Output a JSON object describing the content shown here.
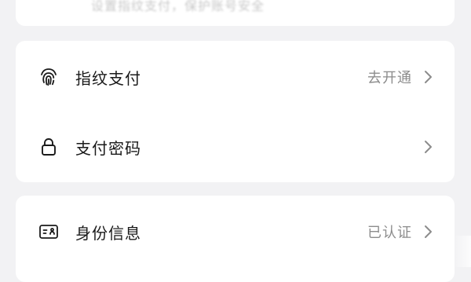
{
  "top_card": {
    "faded_text": "设置指纹支付，保护账号安全"
  },
  "security_section": {
    "items": [
      {
        "label": "指纹支付",
        "value": "去开通",
        "icon": "fingerprint-icon"
      },
      {
        "label": "支付密码",
        "value": "",
        "icon": "lock-icon"
      }
    ]
  },
  "identity_section": {
    "items": [
      {
        "label": "身份信息",
        "value": "已认证",
        "icon": "id-card-icon"
      }
    ]
  },
  "colors": {
    "background": "#f2f2f4",
    "card": "#ffffff",
    "label_text": "#1a1a1a",
    "value_text": "#8c8c8c",
    "chevron": "#8c8c8c"
  }
}
